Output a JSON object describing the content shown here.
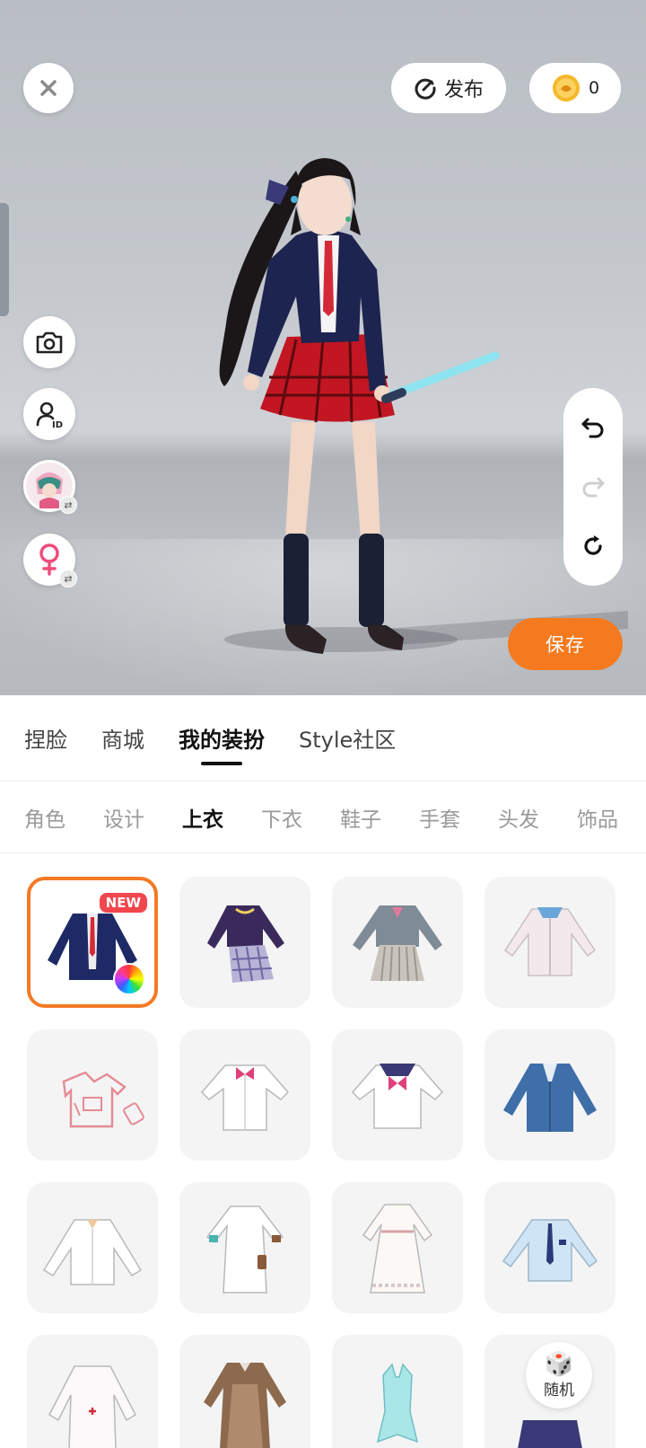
{
  "header": {
    "publish_label": "发布",
    "coin_count": "0"
  },
  "actions": {
    "save_label": "保存",
    "random_label": "随机"
  },
  "main_tabs": [
    {
      "label": "捏脸"
    },
    {
      "label": "商城"
    },
    {
      "label": "我的装扮",
      "active": true
    },
    {
      "label": "Style社区"
    }
  ],
  "sub_tabs": [
    {
      "label": "角色"
    },
    {
      "label": "设计"
    },
    {
      "label": "上衣",
      "active": true
    },
    {
      "label": "下衣"
    },
    {
      "label": "鞋子"
    },
    {
      "label": "手套"
    },
    {
      "label": "头发"
    },
    {
      "label": "饰品"
    }
  ],
  "items": {
    "first_badge": "NEW"
  },
  "colors": {
    "accent_orange": "#f57a1f",
    "new_badge_red": "#f2464e",
    "coin_yellow": "#f5b82a"
  }
}
